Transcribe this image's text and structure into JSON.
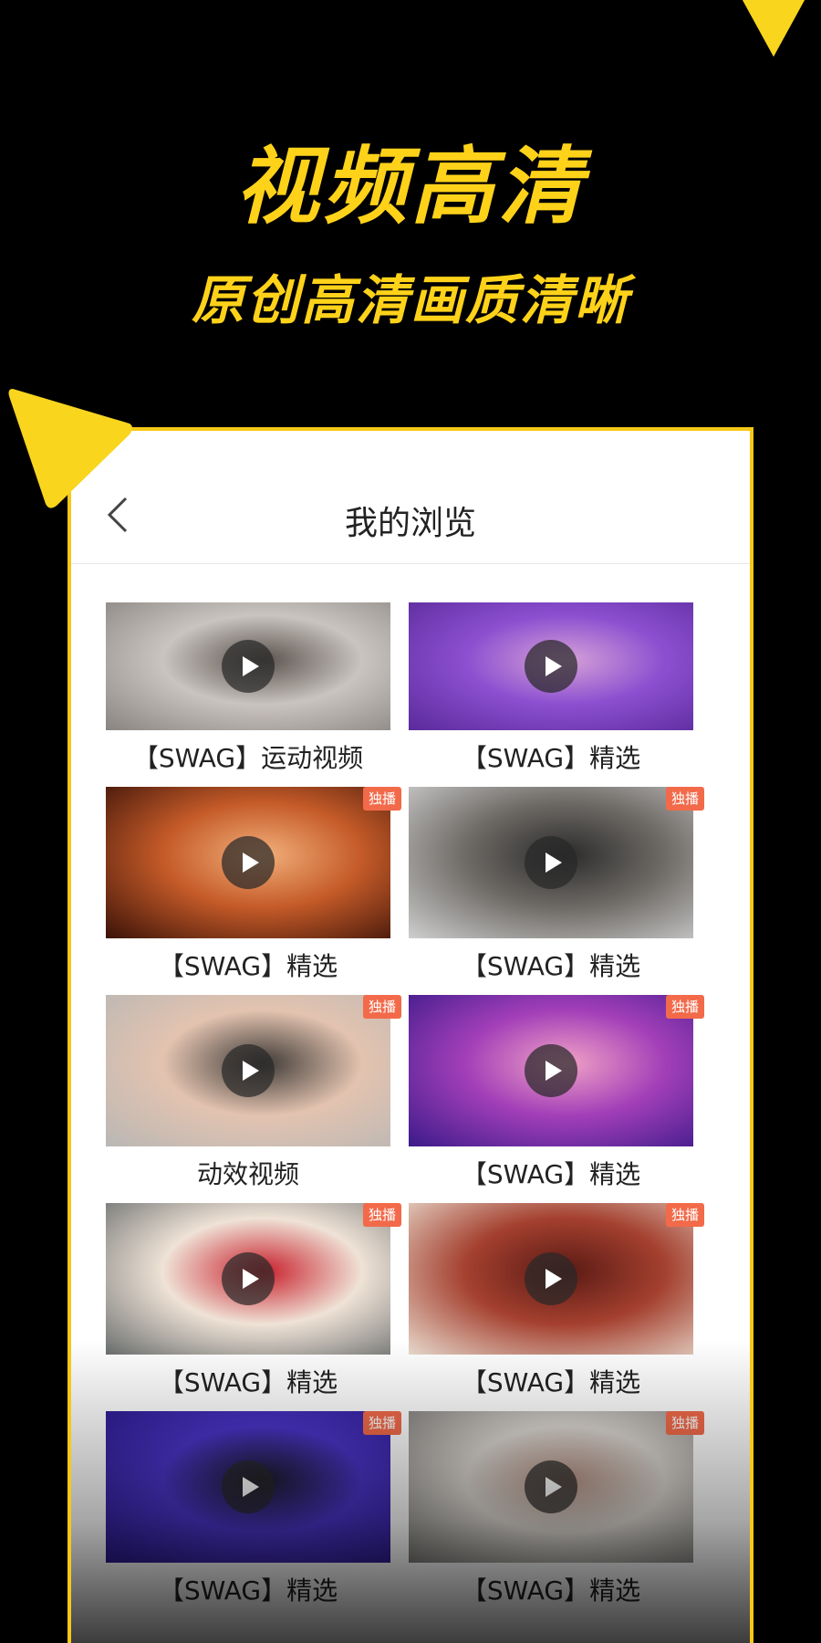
{
  "promo": {
    "headline": "视频高清",
    "subline": "原创高清画质清晰",
    "accent_color": "#ffd21a"
  },
  "screen": {
    "title": "我的浏览",
    "back_icon": "chevron-left-icon"
  },
  "videos": [
    {
      "caption": "【SWAG】运动视频",
      "badge": "",
      "thumb": [
        "#8a8480",
        "#c9c4bf",
        "#5a524d"
      ]
    },
    {
      "caption": "【SWAG】精选",
      "badge": "",
      "thumb": [
        "#5a2a9a",
        "#8c4fd0",
        "#d6a2d8"
      ]
    },
    {
      "caption": "【SWAG】精选",
      "badge": "独播",
      "thumb": [
        "#3a1208",
        "#c45a28",
        "#f2b07a"
      ]
    },
    {
      "caption": "【SWAG】精选",
      "badge": "独播",
      "thumb": [
        "#cfcfcf",
        "#6e6a66",
        "#2b2b2b"
      ]
    },
    {
      "caption": "动效视频",
      "badge": "独播",
      "thumb": [
        "#b9b7b4",
        "#e3c3b0",
        "#3e3a36"
      ]
    },
    {
      "caption": "【SWAG】精选",
      "badge": "独播",
      "thumb": [
        "#3b1a8a",
        "#a33fb8",
        "#f0a2c6"
      ]
    },
    {
      "caption": "【SWAG】精选",
      "badge": "独播",
      "thumb": [
        "#6a6e6e",
        "#efe2d6",
        "#c81e2a"
      ]
    },
    {
      "caption": "【SWAG】精选",
      "badge": "独播",
      "thumb": [
        "#e9dccf",
        "#a4402f",
        "#5a1a14"
      ]
    },
    {
      "caption": "【SWAG】精选",
      "badge": "独播",
      "thumb": [
        "#2a1a8a",
        "#4a34c8",
        "#1b1b2a"
      ]
    },
    {
      "caption": "【SWAG】精选",
      "badge": "独播",
      "thumb": [
        "#7c7a77",
        "#dcd8d2",
        "#b89688"
      ]
    }
  ]
}
